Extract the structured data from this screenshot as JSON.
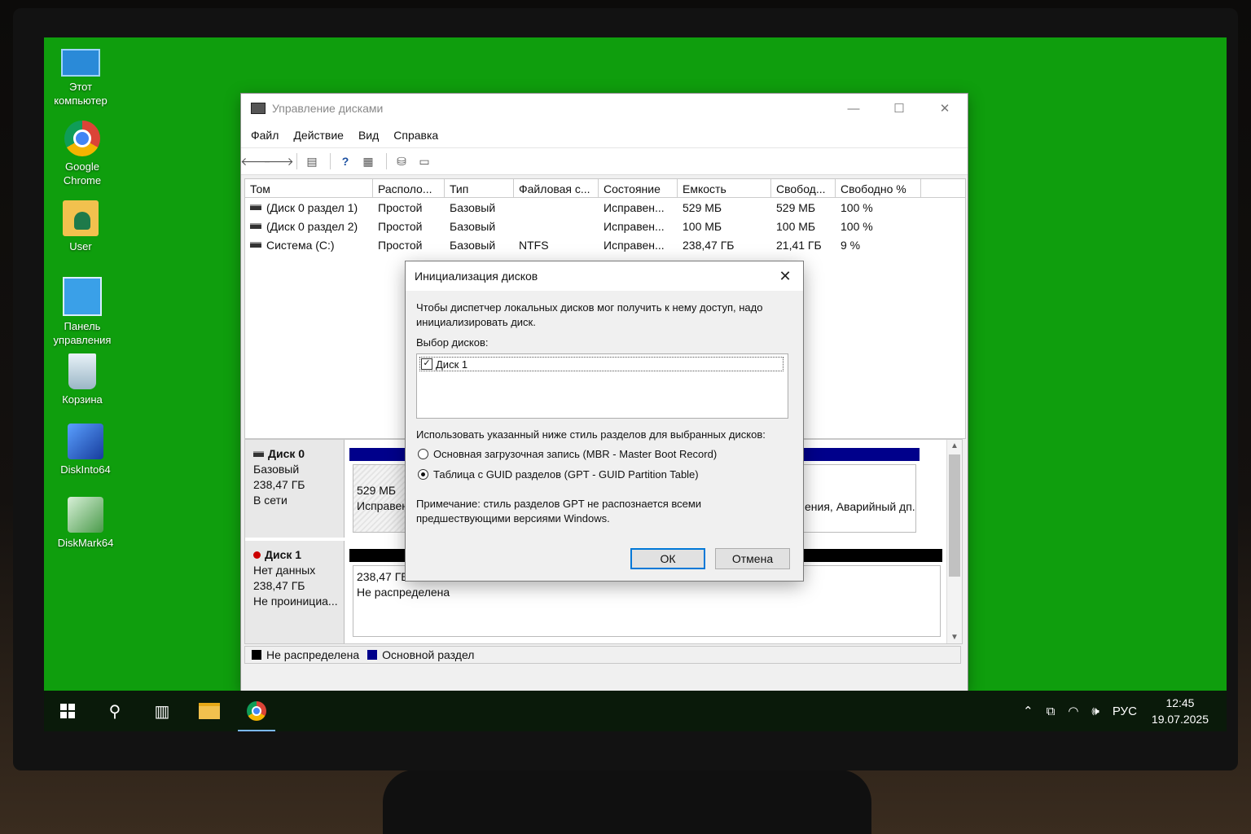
{
  "desktop": {
    "icons": [
      {
        "label": "Этот компьютер",
        "icon": "computer-icon"
      },
      {
        "label": "Google Chrome",
        "icon": "chrome-icon"
      },
      {
        "label": "User",
        "icon": "user-folder-icon"
      },
      {
        "label": "Панель управления",
        "icon": "control-panel-icon"
      },
      {
        "label": "Корзина",
        "icon": "recycle-bin-icon"
      },
      {
        "label": "DiskInto64",
        "icon": "diskinfo-icon"
      },
      {
        "label": "DiskMark64",
        "icon": "diskmark-icon"
      }
    ]
  },
  "window": {
    "title": "Управление дисками",
    "controls": {
      "minimize": "—",
      "maximize": "☐",
      "close": "✕"
    },
    "menu": [
      "Файл",
      "Действие",
      "Вид",
      "Справка"
    ],
    "columns": [
      "Том",
      "Располо...",
      "Тип",
      "Файловая с...",
      "Состояние",
      "Емкость",
      "Свобод...",
      "Свободно %"
    ],
    "volumes": [
      [
        "(Диск 0 раздел 1)",
        "Простой",
        "Базовый",
        "",
        "Исправен...",
        "529 МБ",
        "529 МБ",
        "100 %"
      ],
      [
        "(Диск 0 раздел 2)",
        "Простой",
        "Базовый",
        "",
        "Исправен...",
        "100 МБ",
        "100 МБ",
        "100 %"
      ],
      [
        "Система (C:)",
        "Простой",
        "Базовый",
        "NTFS",
        "Исправен...",
        "238,47 ГБ",
        "21,41 ГБ",
        "9 %"
      ]
    ],
    "disks": [
      {
        "name": "Диск 0",
        "type": "Базовый",
        "size": "238,47 ГБ",
        "status": "В сети",
        "partition": {
          "size": "529 МБ",
          "status": "Исправен"
        },
        "partition_tail": "ения, Аварийный дп.."
      },
      {
        "name": "Диск 1",
        "type": "Нет данных",
        "size": "238,47 ГБ",
        "status": "Не проинициа...",
        "partition": {
          "size": "238,47 ГБ",
          "status": "Не распределена"
        }
      }
    ],
    "legend": [
      {
        "label": "Не распределена",
        "color": "#000000"
      },
      {
        "label": "Основной раздел",
        "color": "#00008b"
      }
    ]
  },
  "dialog": {
    "title": "Инициализация дисков",
    "close": "✕",
    "intro": "Чтобы диспетчер локальных дисков мог получить к нему доступ, надо инициализировать диск.",
    "select_label": "Выбор дисков:",
    "disk_item": {
      "label": "Диск 1",
      "checked": true,
      "check": "✓"
    },
    "style_label": "Использовать указанный ниже стиль разделов для выбранных дисков:",
    "options": [
      {
        "label": "Основная загрузочная запись (MBR - Master Boot Record)",
        "selected": false
      },
      {
        "label": "Таблица с GUID разделов (GPT - GUID Partition Table)",
        "selected": true
      }
    ],
    "note": "Примечание: стиль разделов GPT не распознается всеми предшествующими версиями Windows.",
    "ok": "ОК",
    "cancel": "Отмена"
  },
  "taskbar": {
    "language": "РУС",
    "time": "12:45",
    "date": "19.07.2025"
  },
  "colors": {
    "desktop": "#0f9e0d",
    "primary_partition": "#00008b",
    "unallocated": "#000000",
    "ok_border": "#0078d7"
  }
}
